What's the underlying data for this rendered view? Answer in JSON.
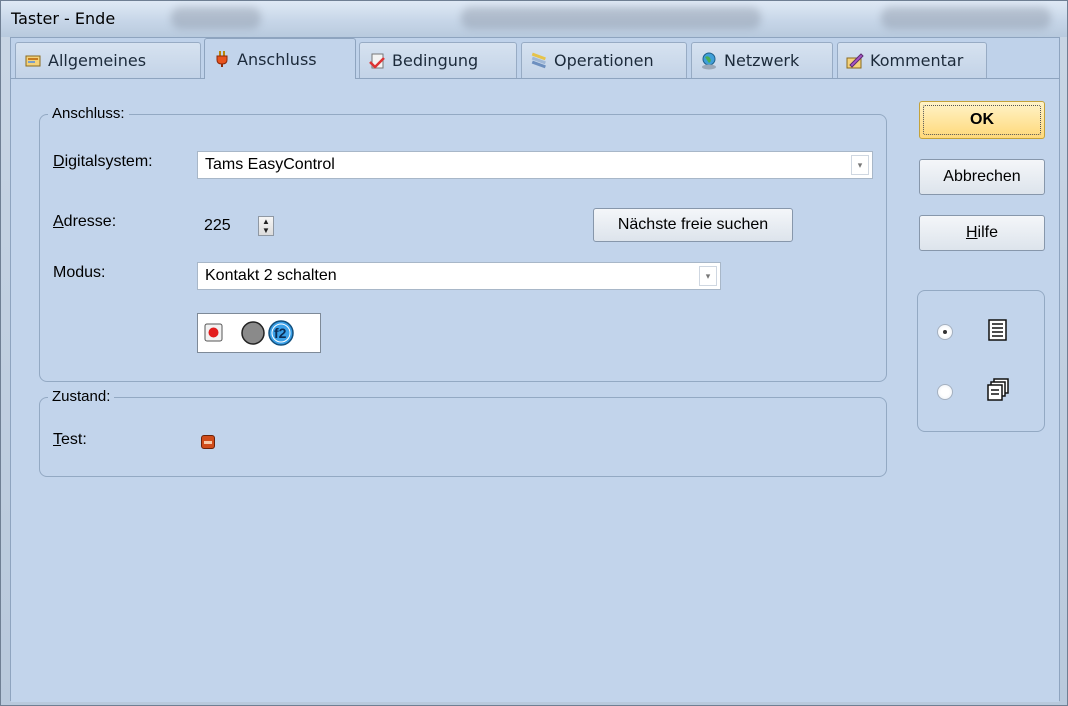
{
  "window": {
    "title": "Taster - Ende"
  },
  "tabs": [
    {
      "label": "Allgemeines",
      "icon": "general-icon"
    },
    {
      "label": "Anschluss",
      "icon": "plug-icon",
      "active": true
    },
    {
      "label": "Bedingung",
      "icon": "condition-icon"
    },
    {
      "label": "Operationen",
      "icon": "operations-icon"
    },
    {
      "label": "Netzwerk",
      "icon": "network-icon"
    },
    {
      "label": "Kommentar",
      "icon": "comment-icon"
    }
  ],
  "anschluss": {
    "group_label": "Anschluss:",
    "digitalsystem_label_u": "D",
    "digitalsystem_label_rest": "igitalsystem:",
    "digitalsystem_value": "Tams EasyControl",
    "adresse_label_u": "A",
    "adresse_label_rest": "dresse:",
    "adresse_value": "225",
    "find_button": "Nächste freie suchen",
    "modus_label": "Modus:",
    "modus_value": "Kontakt 2 schalten",
    "function_badge": "f2"
  },
  "zustand": {
    "group_label": "Zustand:",
    "test_label_u": "T",
    "test_label_rest": "est:"
  },
  "buttons": {
    "ok": "OK",
    "cancel": "Abbrechen",
    "help_u": "H",
    "help_rest": "ilfe"
  },
  "view_options": {
    "selected": "list",
    "items": [
      {
        "icon": "list-view-icon",
        "selected": true
      },
      {
        "icon": "cascade-view-icon",
        "selected": false
      }
    ]
  },
  "colors": {
    "accent_ok": "#ffd97a",
    "led_red": "#e31d1d",
    "badge_blue": "#3aa0e8"
  }
}
